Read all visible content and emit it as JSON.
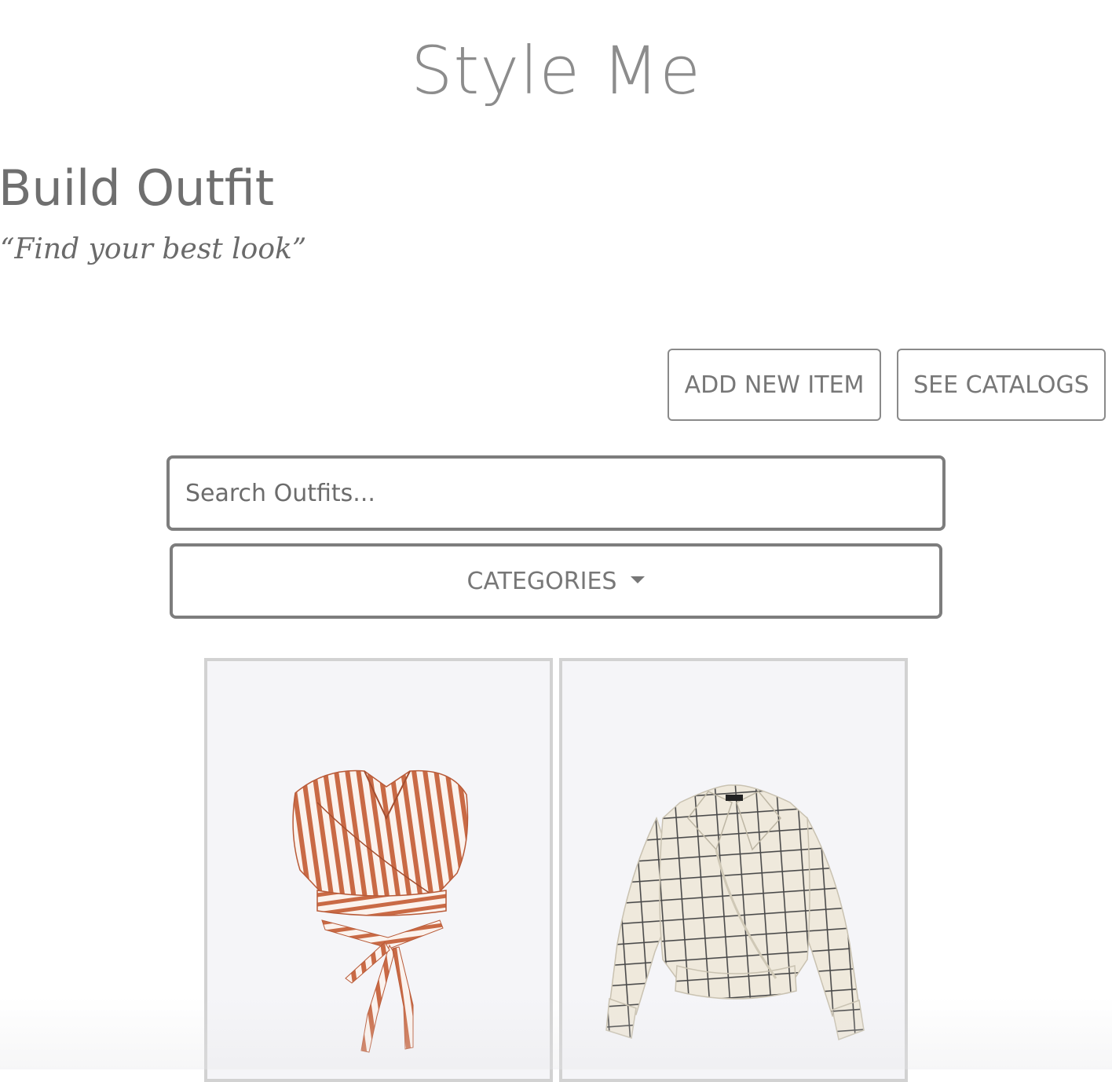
{
  "header": {
    "app_title": "Style Me"
  },
  "page": {
    "heading": "Build Outfit",
    "tagline": "“Find your best look”"
  },
  "actions": {
    "add_new_item": "ADD NEW ITEM",
    "see_catalogs": "SEE CATALOGS"
  },
  "search": {
    "placeholder": "Search Outfits...",
    "value": ""
  },
  "filters": {
    "categories_label": "CATEGORIES"
  },
  "items": [
    {
      "image": "striped-wrap-crop-top",
      "accent_color": "#c96a45"
    },
    {
      "image": "checked-wrap-blouse",
      "accent_color": "#efe9dc"
    }
  ],
  "colors": {
    "text_gray": "#777777",
    "border_gray": "#7d7d7d",
    "card_border": "#d2d2d2",
    "card_bg": "#f5f5f8"
  }
}
